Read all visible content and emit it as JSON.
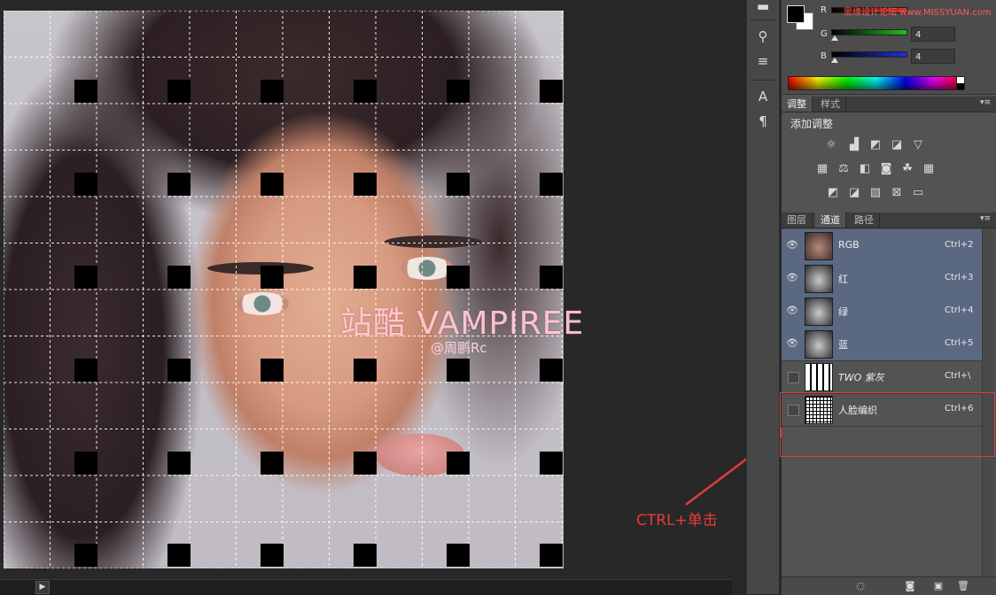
{
  "canvas": {
    "watermark_main": "站酷 VAMPIREE",
    "watermark_sub": "@周鹏Rc",
    "annotation": "CTRL+单击"
  },
  "color_panel": {
    "channels": [
      {
        "label": "R",
        "value": "",
        "color": "#e03030"
      },
      {
        "label": "G",
        "value": "4",
        "color": "#20a020"
      },
      {
        "label": "B",
        "value": "4",
        "color": "#2030c0"
      }
    ],
    "site_watermark": "思缘设计论坛 www.MISSYUAN.com"
  },
  "adjust_panel": {
    "tabs": [
      "调整",
      "样式"
    ],
    "active_tab": "调整",
    "title": "添加调整",
    "icons_row1": [
      "brightness-icon",
      "levels-icon",
      "curves-icon",
      "exposure-icon",
      "vibrance-icon"
    ],
    "icons_row2": [
      "hue-saturation-icon",
      "color-balance-icon",
      "black-white-icon",
      "photo-filter-icon",
      "channel-mixer-icon",
      "color-lookup-icon"
    ],
    "icons_row3": [
      "invert-icon",
      "posterize-icon",
      "threshold-icon",
      "selective-color-icon",
      "gradient-map-icon"
    ]
  },
  "channels_panel": {
    "tabs": [
      "图层",
      "通道",
      "路径"
    ],
    "active_tab": "通道",
    "rows": [
      {
        "name": "RGB",
        "shortcut": "Ctrl+2",
        "visible": true,
        "selected": true,
        "thumb": "color"
      },
      {
        "name": "红",
        "shortcut": "Ctrl+3",
        "visible": true,
        "selected": true,
        "thumb": "gray"
      },
      {
        "name": "绿",
        "shortcut": "Ctrl+4",
        "visible": true,
        "selected": true,
        "thumb": "gray"
      },
      {
        "name": "蓝",
        "shortcut": "Ctrl+5",
        "visible": true,
        "selected": true,
        "thumb": "gray"
      },
      {
        "name": "TWO 紫灰",
        "shortcut": "Ctrl+\\",
        "visible": false,
        "selected": false,
        "thumb": "stripes"
      },
      {
        "name": "人脸编织",
        "shortcut": "Ctrl+6",
        "visible": false,
        "selected": false,
        "thumb": "grid"
      }
    ]
  }
}
